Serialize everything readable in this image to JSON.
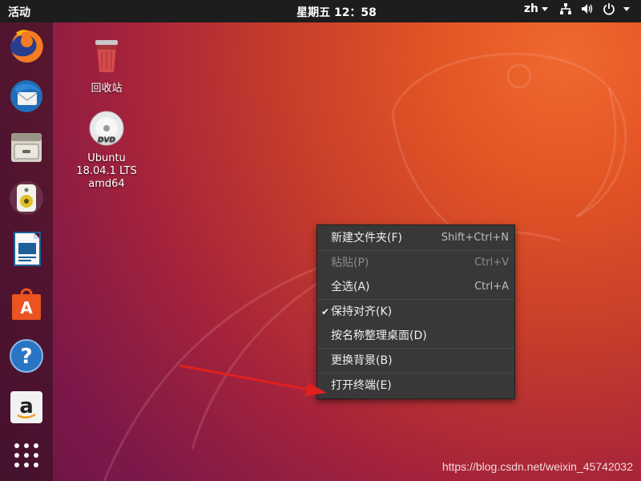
{
  "topbar": {
    "activities": "活动",
    "clock": "星期五 12：58",
    "lang": "zh"
  },
  "dock": {
    "items": [
      {
        "name": "firefox-icon"
      },
      {
        "name": "thunderbird-icon"
      },
      {
        "name": "files-icon"
      },
      {
        "name": "rhythmbox-icon"
      },
      {
        "name": "writer-icon"
      },
      {
        "name": "software-icon"
      },
      {
        "name": "help-icon"
      },
      {
        "name": "amazon-icon"
      },
      {
        "name": "show-apps-icon"
      }
    ]
  },
  "desktop": {
    "trash_label": "回收站",
    "dvd_line1": "Ubuntu",
    "dvd_line2": "18.04.1 LTS",
    "dvd_line3": "amd64"
  },
  "context_menu": {
    "items": [
      {
        "label": "新建文件夹(F)",
        "accel": "Shift+Ctrl+N"
      },
      {
        "label": "粘贴(P)",
        "accel": "Ctrl+V"
      },
      {
        "label": "全选(A)",
        "accel": "Ctrl+A"
      },
      {
        "label": "保持对齐(K)",
        "accel": ""
      },
      {
        "label": "按名称整理桌面(D)",
        "accel": ""
      },
      {
        "label": "更换背景(B)",
        "accel": ""
      },
      {
        "label": "打开终端(E)",
        "accel": ""
      }
    ]
  },
  "watermark": "https://blog.csdn.net/weixin_45742032",
  "colors": {
    "topbar": "#1d1d1d",
    "menu_bg": "#383838",
    "arrow": "#e0201f"
  }
}
